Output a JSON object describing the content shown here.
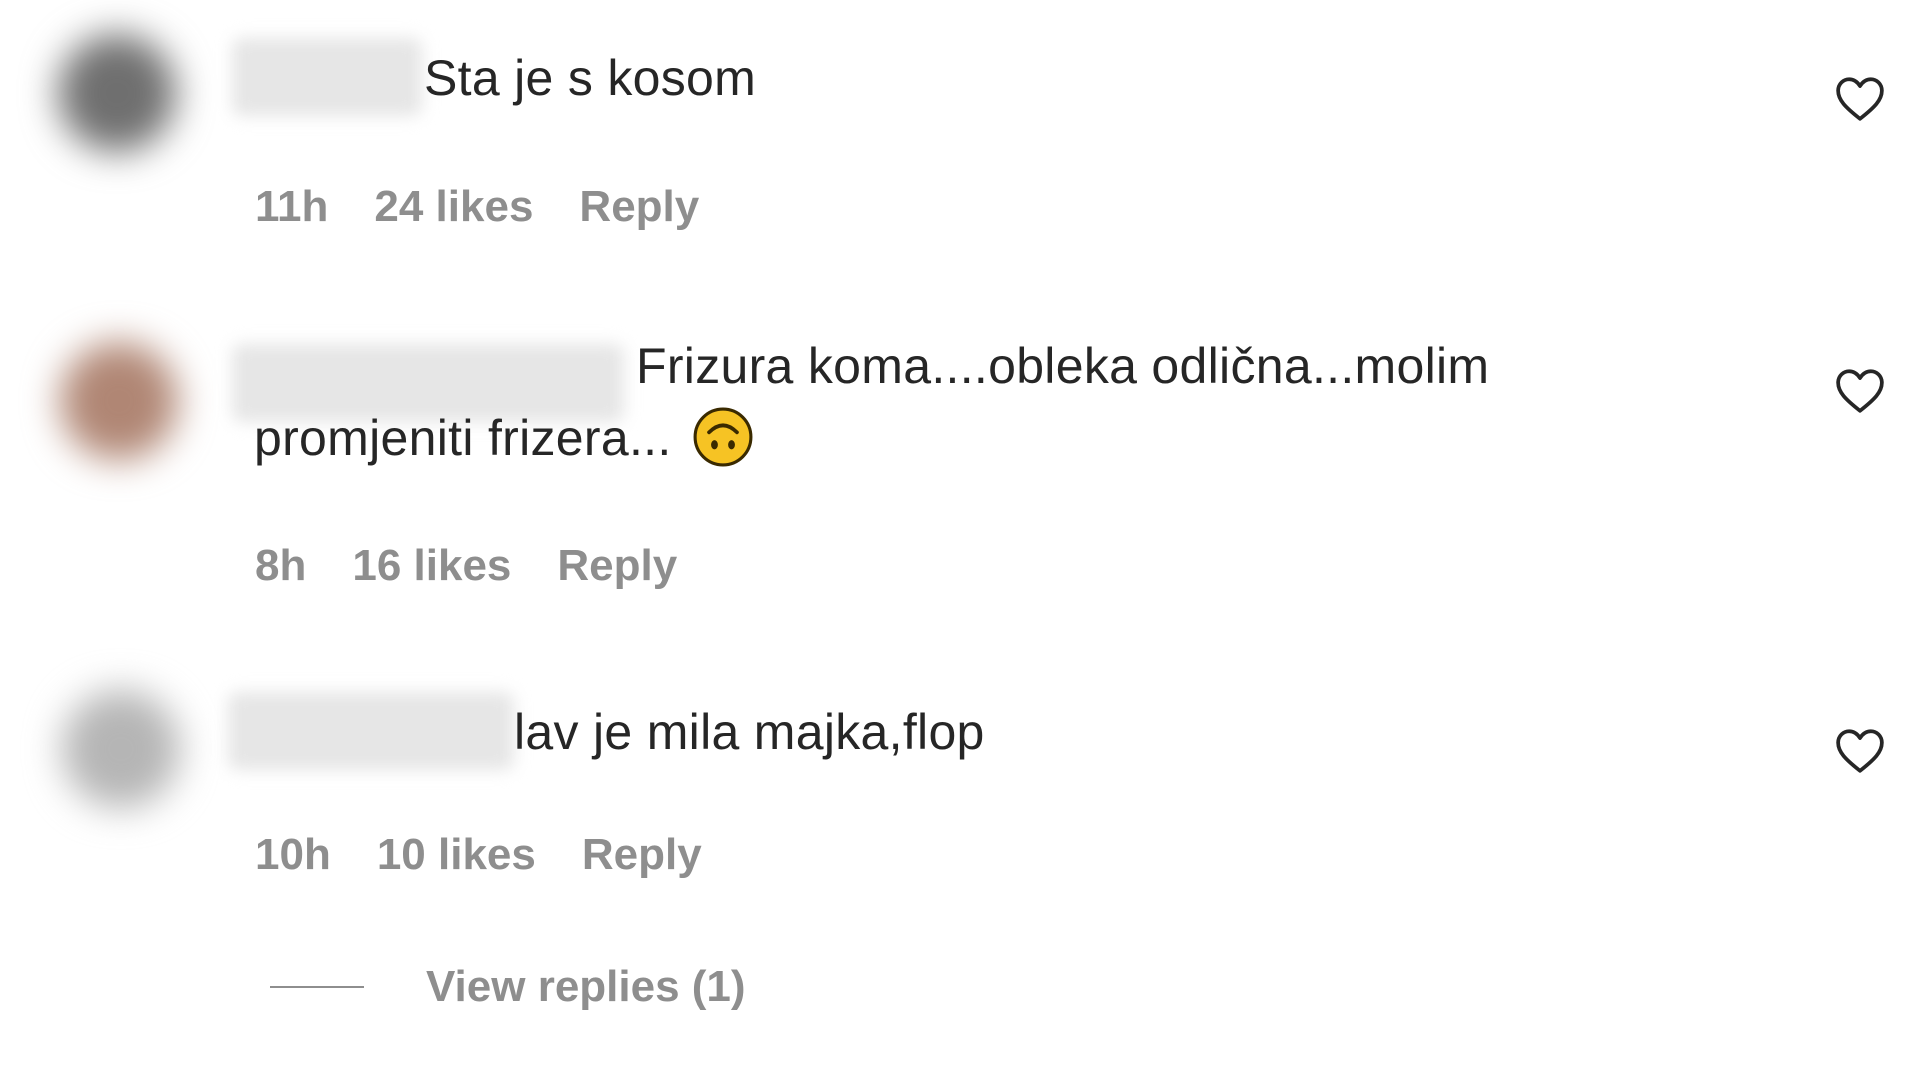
{
  "comments": [
    {
      "text": "Sta je s kosom",
      "time": "11h",
      "likes": "24 likes",
      "reply_label": "Reply",
      "avatar_color": "#707070"
    },
    {
      "text": "Frizura koma....obleka odlična...molim promjeniti frizera...",
      "time": "8h",
      "likes": "16 likes",
      "reply_label": "Reply",
      "avatar_color": "#b08a78",
      "emoji": "upside-down-face-emoji"
    },
    {
      "text": "lav je mila majka,flop",
      "time": "10h",
      "likes": "10 likes",
      "reply_label": "Reply",
      "avatar_color": "#b8b8b8"
    }
  ],
  "view_replies": {
    "label": "View replies (1)"
  },
  "icons": {
    "like": "heart-outline-icon"
  },
  "colors": {
    "text": "#262626",
    "secondary": "#8e8e8e",
    "emoji": "#f6c324"
  }
}
